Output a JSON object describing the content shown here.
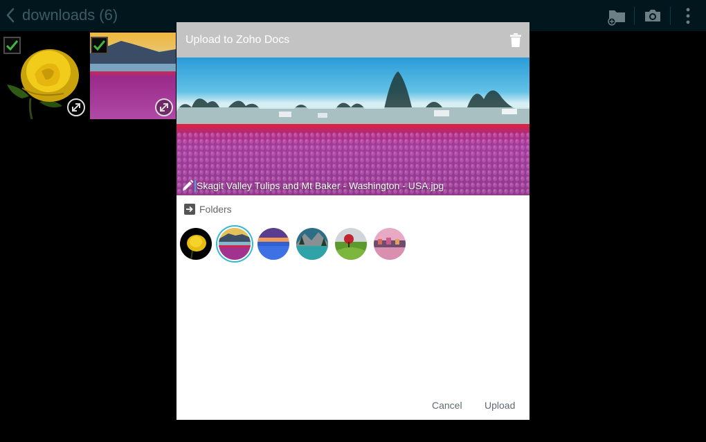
{
  "actionbar": {
    "title": "downloads (6)",
    "icons": [
      "back-arrow-icon",
      "new-folder-icon",
      "camera-icon",
      "overflow-menu-icon"
    ]
  },
  "gallery": {
    "items": [
      {
        "name": "yellow-rose",
        "checked": true
      },
      {
        "name": "tulip-field",
        "checked": true
      }
    ]
  },
  "dialog": {
    "title": "Upload to Zoho Docs",
    "delete_icon": "trash-icon",
    "preview": {
      "filename": "Skagit Valley Tulips and Mt Baker - Washington - USA.jpg",
      "edit_icon": "pencil-icon"
    },
    "folders_label": "Folders",
    "folders_icon": "folder-arrow-icon",
    "thumbnails": [
      {
        "name": "yellow-rose",
        "selected": false
      },
      {
        "name": "tulip-field",
        "selected": true
      },
      {
        "name": "blue-flowers",
        "selected": false
      },
      {
        "name": "mountain-lake",
        "selected": false
      },
      {
        "name": "red-tree-field",
        "selected": false
      },
      {
        "name": "waterfront-town",
        "selected": false
      }
    ],
    "cancel_label": "Cancel",
    "upload_label": "Upload"
  },
  "colors": {
    "actionbar_bg": "#02171d",
    "dialog_header_bg": "#c3c3c3",
    "accent": "#34b8d6",
    "check_green": "#3fb83f"
  }
}
